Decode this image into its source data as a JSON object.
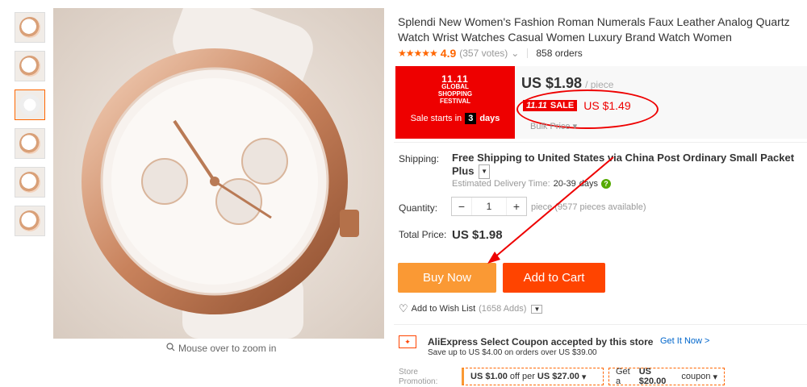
{
  "product": {
    "title": "Splendi New Women's Fashion Roman Numerals Faux Leather Analog Quartz Watch Wrist Watches Casual Women Luxury Brand Watch Women",
    "stars": "★★★★★",
    "rating": "4.9",
    "votes": "(357 votes)",
    "orders": "858 orders"
  },
  "gallery": {
    "thumb_count": 6,
    "zoom_hint": "Mouse over to zoom in"
  },
  "festival": {
    "logo_mark": "11.11",
    "logo_line1": "GLOBAL SHOPPING",
    "logo_line2": "FESTIVAL",
    "sale_starts_prefix": "Sale starts in",
    "days_number": "3",
    "days_label": "days"
  },
  "price": {
    "main": "US $1.98",
    "unit": "/ piece",
    "sale_event": "11.11",
    "sale_badge": "SALE",
    "sale_price": "US $1.49",
    "bulk": "Bulk Price"
  },
  "shipping": {
    "label": "Shipping:",
    "free": "Free Shipping",
    "to": "to United States via China Post Ordinary Small Packet Plus",
    "delivery_label": "Estimated Delivery Time:",
    "delivery_days": "20-39",
    "delivery_unit": "days"
  },
  "quantity": {
    "label": "Quantity:",
    "value": "1",
    "unit_note": "piece (9577 pieces available)"
  },
  "total": {
    "label": "Total Price:",
    "value": "US $1.98"
  },
  "actions": {
    "buy_now": "Buy Now",
    "add_to_cart": "Add to Cart",
    "wish_list": "Add to Wish List",
    "wish_count": "(1658 Adds)"
  },
  "coupon": {
    "title": "AliExpress Select Coupon accepted by this store",
    "link": "Get It Now >",
    "sub": "Save up to US $4.00 on orders over US $39.00"
  },
  "store_promo": {
    "label": "Store Promotion:",
    "promo1_amount": "US $1.00",
    "promo1_mid": "off per",
    "promo1_threshold": "US $27.00",
    "promo2_prefix": "Get a",
    "promo2_amount": "US $20.00",
    "promo2_suffix": "coupon"
  },
  "colors": {
    "accent_orange": "#fa9934",
    "cart_red": "#ff4400",
    "sale_red": "#ee0000"
  }
}
